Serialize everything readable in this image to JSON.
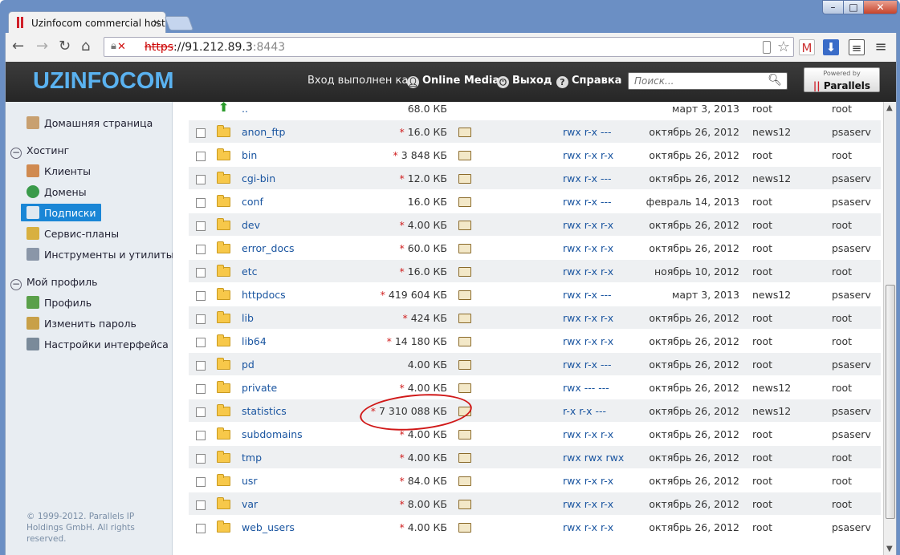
{
  "browser": {
    "tab_title": "Uzinfocom commercial hosting",
    "url_scheme": "https",
    "url_host": "://91.212.89.3",
    "url_port": ":8443"
  },
  "header": {
    "logo": "UZINFOCOM",
    "login_label": "Вход выполнен как",
    "user_name": "Online Media",
    "logout_label": "Выход",
    "help_label": "Справка",
    "search_placeholder": "Поиск...",
    "powered_by": "Powered by",
    "powered_brand": "Parallels"
  },
  "sidebar": {
    "home": "Домашняя страница",
    "hosting": "Хостинг",
    "clients": "Клиенты",
    "domains": "Домены",
    "subscriptions": "Подписки",
    "service_plans": "Сервис-планы",
    "tools": "Инструменты и утилиты",
    "my_profile": "Мой профиль",
    "profile": "Профиль",
    "change_password": "Изменить пароль",
    "interface_settings": "Настройки интерфейса",
    "copyright": "© 1999-2012. Parallels IP Holdings GmbH. All rights reserved."
  },
  "files": [
    {
      "name": "..",
      "size": "68.0 КБ",
      "flag": "",
      "perm": "",
      "date": "март 3, 2013",
      "user": "root",
      "group": "root",
      "up": true
    },
    {
      "name": "anon_ftp",
      "size": "16.0 КБ",
      "flag": "*",
      "perm": "rwx r-x ---",
      "date": "октябрь 26, 2012",
      "user": "news12",
      "group": "psaserv"
    },
    {
      "name": "bin",
      "size": "3 848 КБ",
      "flag": "*",
      "perm": "rwx r-x r-x",
      "date": "октябрь 26, 2012",
      "user": "root",
      "group": "root"
    },
    {
      "name": "cgi-bin",
      "size": "12.0 КБ",
      "flag": "*",
      "perm": "rwx r-x ---",
      "date": "октябрь 26, 2012",
      "user": "news12",
      "group": "psaserv"
    },
    {
      "name": "conf",
      "size": "16.0 КБ",
      "flag": "",
      "perm": "rwx r-x ---",
      "date": "февраль 14, 2013",
      "user": "root",
      "group": "psaserv"
    },
    {
      "name": "dev",
      "size": "4.00 КБ",
      "flag": "*",
      "perm": "rwx r-x r-x",
      "date": "октябрь 26, 2012",
      "user": "root",
      "group": "root"
    },
    {
      "name": "error_docs",
      "size": "60.0 КБ",
      "flag": "*",
      "perm": "rwx r-x r-x",
      "date": "октябрь 26, 2012",
      "user": "root",
      "group": "psaserv"
    },
    {
      "name": "etc",
      "size": "16.0 КБ",
      "flag": "*",
      "perm": "rwx r-x r-x",
      "date": "ноябрь 10, 2012",
      "user": "root",
      "group": "root"
    },
    {
      "name": "httpdocs",
      "size": "419 604 КБ",
      "flag": "*",
      "perm": "rwx r-x ---",
      "date": "март 3, 2013",
      "user": "news12",
      "group": "psaserv"
    },
    {
      "name": "lib",
      "size": "424 КБ",
      "flag": "*",
      "perm": "rwx r-x r-x",
      "date": "октябрь 26, 2012",
      "user": "root",
      "group": "root"
    },
    {
      "name": "lib64",
      "size": "14 180 КБ",
      "flag": "*",
      "perm": "rwx r-x r-x",
      "date": "октябрь 26, 2012",
      "user": "root",
      "group": "root"
    },
    {
      "name": "pd",
      "size": "4.00 КБ",
      "flag": "",
      "perm": "rwx r-x ---",
      "date": "октябрь 26, 2012",
      "user": "root",
      "group": "psaserv"
    },
    {
      "name": "private",
      "size": "4.00 КБ",
      "flag": "*",
      "perm": "rwx --- ---",
      "date": "октябрь 26, 2012",
      "user": "news12",
      "group": "root"
    },
    {
      "name": "statistics",
      "size": "7 310 088 КБ",
      "flag": "*",
      "perm": "r-x r-x ---",
      "date": "октябрь 26, 2012",
      "user": "news12",
      "group": "psaserv"
    },
    {
      "name": "subdomains",
      "size": "4.00 КБ",
      "flag": "*",
      "perm": "rwx r-x r-x",
      "date": "октябрь 26, 2012",
      "user": "root",
      "group": "psaserv"
    },
    {
      "name": "tmp",
      "size": "4.00 КБ",
      "flag": "*",
      "perm": "rwx rwx rwx",
      "date": "октябрь 26, 2012",
      "user": "root",
      "group": "root"
    },
    {
      "name": "usr",
      "size": "84.0 КБ",
      "flag": "*",
      "perm": "rwx r-x r-x",
      "date": "октябрь 26, 2012",
      "user": "root",
      "group": "root"
    },
    {
      "name": "var",
      "size": "8.00 КБ",
      "flag": "*",
      "perm": "rwx r-x r-x",
      "date": "октябрь 26, 2012",
      "user": "root",
      "group": "root"
    },
    {
      "name": "web_users",
      "size": "4.00 КБ",
      "flag": "*",
      "perm": "rwx r-x r-x",
      "date": "октябрь 26, 2012",
      "user": "root",
      "group": "psaserv"
    }
  ]
}
